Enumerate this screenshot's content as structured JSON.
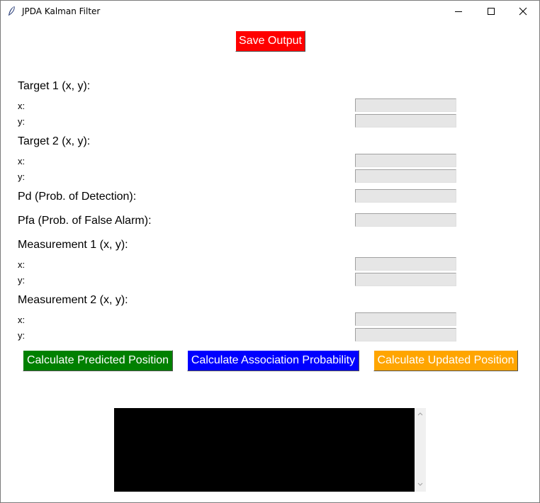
{
  "window": {
    "title": "JPDA Kalman Filter",
    "icon": "feather-icon",
    "controls": {
      "minimize_icon": "minimize-icon",
      "maximize_icon": "maximize-icon",
      "close_icon": "close-icon"
    }
  },
  "buttons": {
    "save": {
      "label": "Save Output",
      "color": "#ff0000"
    },
    "predict": {
      "label": "Calculate Predicted Position",
      "color": "#008000"
    },
    "association": {
      "label": "Calculate Association Probability",
      "color": "#0000ff"
    },
    "update": {
      "label": "Calculate Updated Position",
      "color": "#ffa500"
    }
  },
  "form": {
    "target1": {
      "heading": "Target 1 (x, y):",
      "x_label": "x:",
      "y_label": "y:",
      "x_value": "",
      "y_value": ""
    },
    "target2": {
      "heading": "Target 2 (x, y):",
      "x_label": "x:",
      "y_label": "y:",
      "x_value": "",
      "y_value": ""
    },
    "pd": {
      "label": "Pd (Prob. of Detection):",
      "value": ""
    },
    "pfa": {
      "label": "Pfa (Prob. of False Alarm):",
      "value": ""
    },
    "measurement1": {
      "heading": "Measurement 1 (x, y):",
      "x_label": "x:",
      "y_label": "y:",
      "x_value": "",
      "y_value": ""
    },
    "measurement2": {
      "heading": "Measurement 2 (x, y):",
      "x_label": "x:",
      "y_label": "y:",
      "x_value": "",
      "y_value": ""
    }
  },
  "output": {
    "text": ""
  }
}
